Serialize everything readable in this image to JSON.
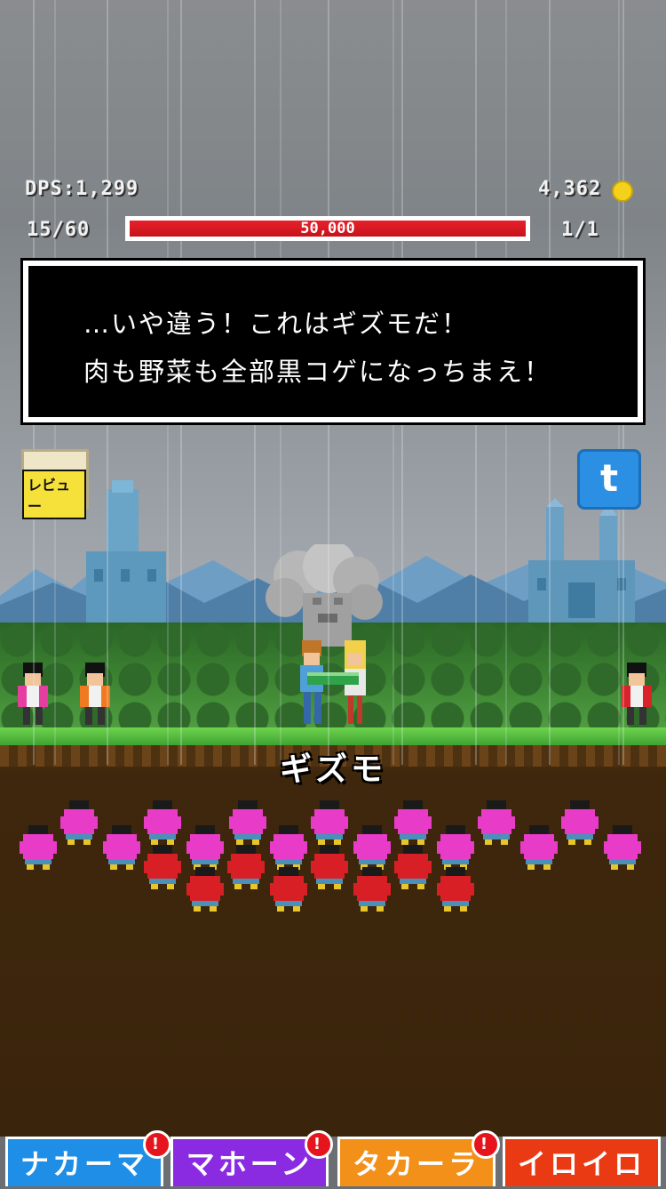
{
  "hud": {
    "dps": "DPS:1,299",
    "coins": "4,362",
    "stage": "15/60",
    "boss_hp": "50,000",
    "wave": "1/1"
  },
  "dialog": {
    "line1": "…いや違う！これはギズモだ！",
    "line2": "肉も野菜も全部黒コゲになっちまえ！"
  },
  "side_buttons": {
    "review_label": "レビュー",
    "twitter_label": "t"
  },
  "enemy": {
    "name": "ギズモ"
  },
  "tabs": [
    {
      "label": "ナカーマ",
      "color": "#1f8ee6",
      "badge": "!"
    },
    {
      "label": "マホーン",
      "color": "#8a2be2",
      "badge": "!"
    },
    {
      "label": "タカーラ",
      "color": "#f39019",
      "badge": "!"
    },
    {
      "label": "イロイロ",
      "color": "#ea3a14",
      "badge": ""
    }
  ],
  "colors": {
    "hp_fill": "#e8212b",
    "coin": "#f4d21c"
  }
}
